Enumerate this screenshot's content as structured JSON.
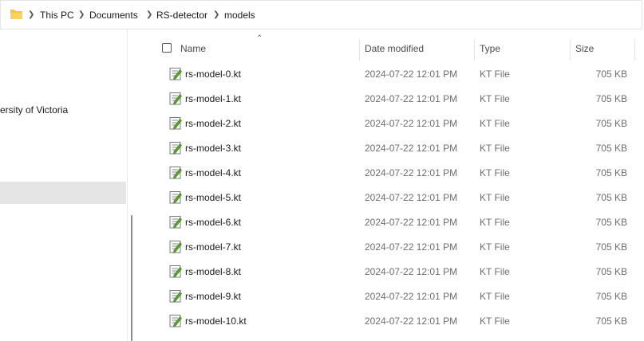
{
  "breadcrumb": [
    "This PC",
    "Documents",
    "RS-detector",
    "models"
  ],
  "nav": {
    "partial_item": "ersity of Victoria"
  },
  "columns": {
    "name": "Name",
    "date": "Date modified",
    "type": "Type",
    "size": "Size"
  },
  "files": [
    {
      "name": "rs-model-0.kt",
      "date": "2024-07-22 12:01 PM",
      "type": "KT File",
      "size": "705 KB"
    },
    {
      "name": "rs-model-1.kt",
      "date": "2024-07-22 12:01 PM",
      "type": "KT File",
      "size": "705 KB"
    },
    {
      "name": "rs-model-2.kt",
      "date": "2024-07-22 12:01 PM",
      "type": "KT File",
      "size": "705 KB"
    },
    {
      "name": "rs-model-3.kt",
      "date": "2024-07-22 12:01 PM",
      "type": "KT File",
      "size": "705 KB"
    },
    {
      "name": "rs-model-4.kt",
      "date": "2024-07-22 12:01 PM",
      "type": "KT File",
      "size": "705 KB"
    },
    {
      "name": "rs-model-5.kt",
      "date": "2024-07-22 12:01 PM",
      "type": "KT File",
      "size": "705 KB"
    },
    {
      "name": "rs-model-6.kt",
      "date": "2024-07-22 12:01 PM",
      "type": "KT File",
      "size": "705 KB"
    },
    {
      "name": "rs-model-7.kt",
      "date": "2024-07-22 12:01 PM",
      "type": "KT File",
      "size": "705 KB"
    },
    {
      "name": "rs-model-8.kt",
      "date": "2024-07-22 12:01 PM",
      "type": "KT File",
      "size": "705 KB"
    },
    {
      "name": "rs-model-9.kt",
      "date": "2024-07-22 12:01 PM",
      "type": "KT File",
      "size": "705 KB"
    },
    {
      "name": "rs-model-10.kt",
      "date": "2024-07-22 12:01 PM",
      "type": "KT File",
      "size": "705 KB"
    }
  ],
  "icons": {
    "folder": "folder-icon",
    "file": "text-file-icon",
    "separator": "chevron-right-icon",
    "sort": "sort-ascending-icon"
  },
  "colors": {
    "folder": "#f5c543",
    "selected_nav": "#e5e5e5",
    "file_pencil": "#5aa02c"
  }
}
